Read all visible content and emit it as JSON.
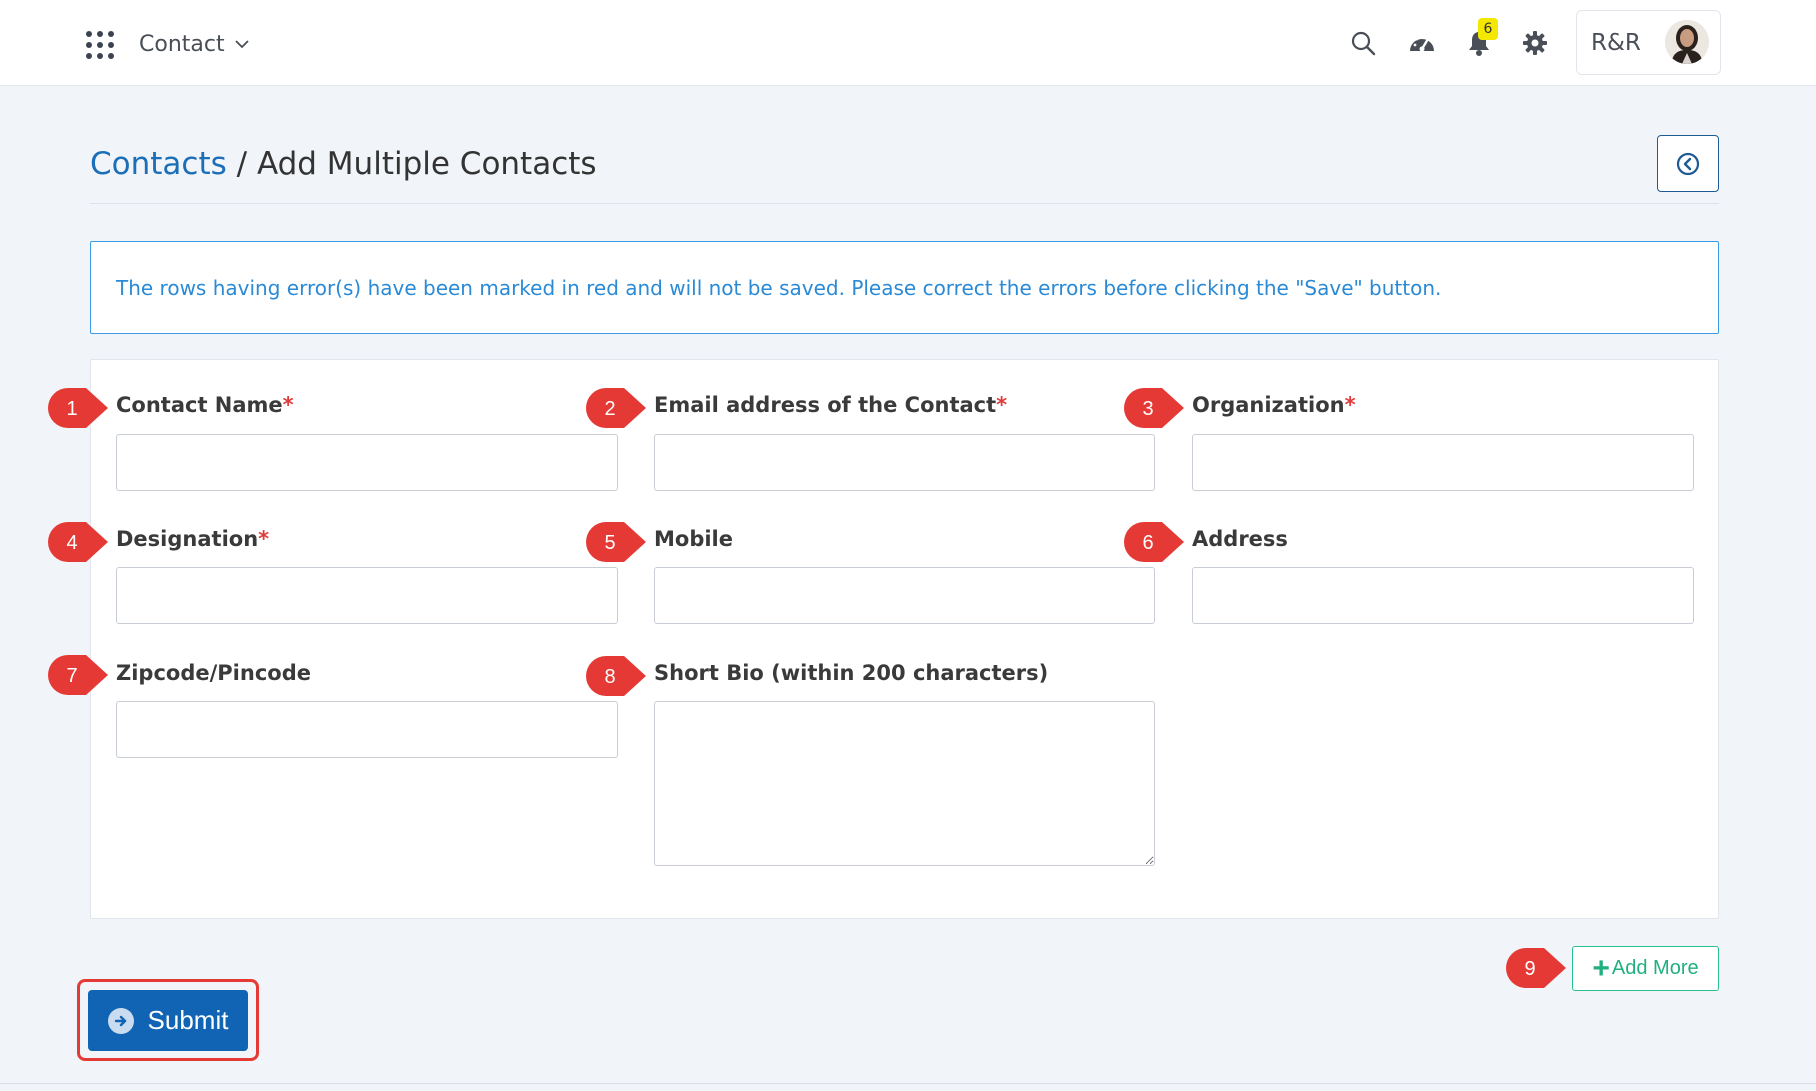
{
  "topbar": {
    "module": "Contact",
    "notification_count": "6",
    "account_initials": "R&R"
  },
  "breadcrumb": {
    "parent": "Contacts",
    "separator": "/",
    "current": "Add Multiple Contacts"
  },
  "info_message": "The rows having error(s) have been marked in red and will not be saved. Please correct the errors before clicking the \"Save\" button.",
  "form": {
    "fields": [
      {
        "label": "Contact Name",
        "required": "*",
        "callout": "1",
        "value": ""
      },
      {
        "label": "Email address of the Contact",
        "required": "*",
        "callout": "2",
        "value": ""
      },
      {
        "label": "Organization",
        "required": "*",
        "callout": "3",
        "value": ""
      },
      {
        "label": "Designation",
        "required": "*",
        "callout": "4",
        "value": ""
      },
      {
        "label": "Mobile",
        "callout": "5",
        "value": ""
      },
      {
        "label": "Address",
        "callout": "6",
        "value": ""
      },
      {
        "label": "Zipcode/Pincode",
        "callout": "7",
        "value": ""
      },
      {
        "label": "Short Bio (within 200 characters)",
        "callout": "8",
        "value": ""
      }
    ]
  },
  "actions": {
    "add_more": "Add More",
    "add_more_callout": "9",
    "submit": "Submit"
  },
  "colors": {
    "link": "#1b6fb8",
    "required": "#e03b3b",
    "info": "#2a8ad6",
    "submit": "#1164b4",
    "add_more": "#20b07f",
    "callout": "#e53935",
    "badge": "#f5e800"
  },
  "icons": {
    "apps": "apps-grid-icon",
    "chevron": "chevron-down-icon",
    "search": "search-icon",
    "dashboard": "dashboard-gauge-icon",
    "notifications": "bell-icon",
    "settings": "gear-icon",
    "back": "circle-arrow-left-icon",
    "submit": "circle-arrow-right-icon",
    "add": "plus-icon"
  }
}
